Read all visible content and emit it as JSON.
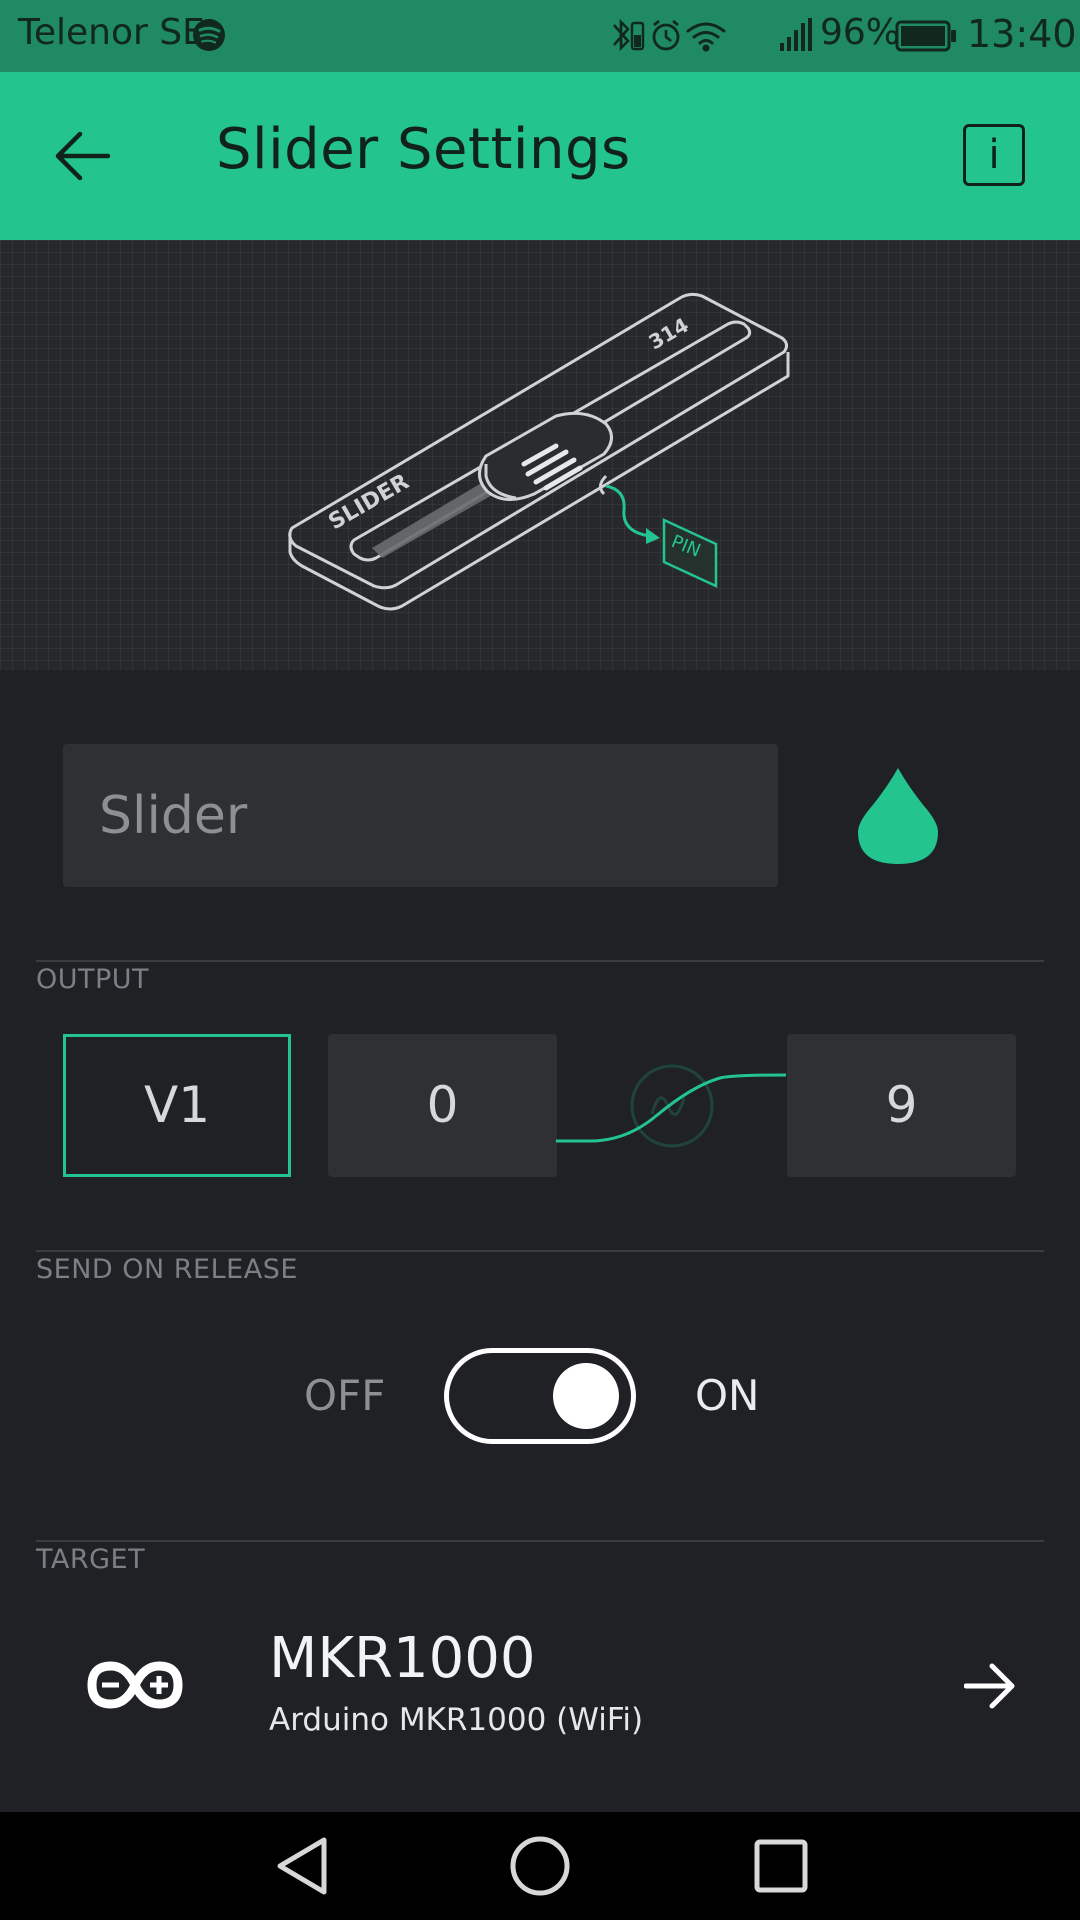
{
  "status_bar": {
    "carrier": "Telenor SE",
    "battery_percent": "96%",
    "time": "13:40"
  },
  "header": {
    "title": "Slider Settings",
    "info_label": "i"
  },
  "illustration": {
    "slider_label": "SLIDER",
    "value_label": "314",
    "pin_label": "PIN"
  },
  "name_field": {
    "placeholder": "Slider",
    "value": ""
  },
  "colors": {
    "accent": "#23c48e",
    "header_bg": "#23c48e",
    "status_bg": "#1f8a63",
    "background": "#1f2125",
    "field_bg": "#2e3034"
  },
  "output": {
    "label": "OUTPUT",
    "pin": "V1",
    "min": "0",
    "max": "9"
  },
  "send_on_release": {
    "label": "SEND ON RELEASE",
    "off_label": "OFF",
    "on_label": "ON",
    "enabled": true
  },
  "target": {
    "label": "TARGET",
    "device_name": "MKR1000",
    "device_desc": "Arduino MKR1000 (WiFi)"
  },
  "icons": {
    "back": "arrow-left-icon",
    "info": "info-icon",
    "color": "droplet-icon",
    "device": "arduino-icon",
    "forward": "arrow-right-icon"
  }
}
